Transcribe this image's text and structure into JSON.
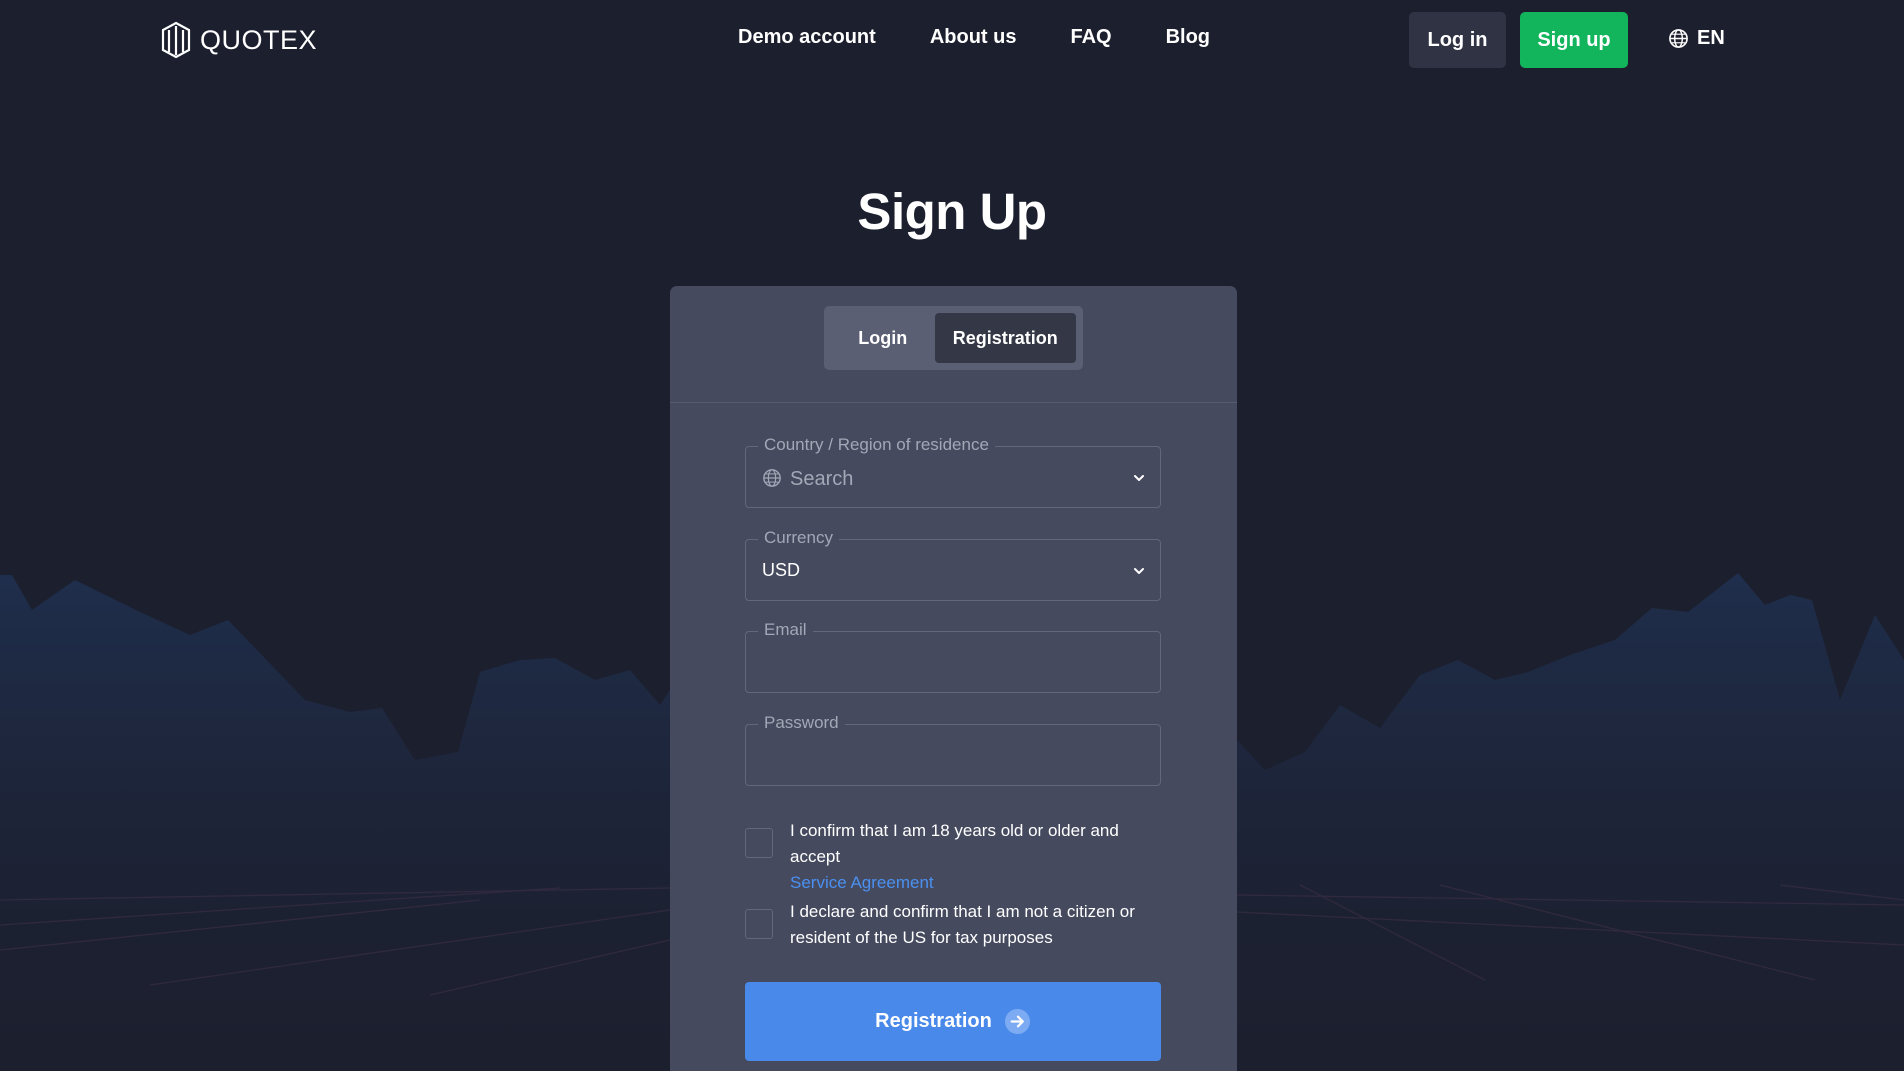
{
  "header": {
    "logo_text": "QUOTEX",
    "nav": [
      "Demo account",
      "About us",
      "FAQ",
      "Blog"
    ],
    "login_label": "Log in",
    "signup_label": "Sign up",
    "language": "EN"
  },
  "page_title": "Sign Up",
  "card": {
    "tabs": [
      {
        "label": "Login",
        "active": false
      },
      {
        "label": "Registration",
        "active": true
      }
    ],
    "country": {
      "label": "Country / Region of residence",
      "placeholder": "Search"
    },
    "currency": {
      "label": "Currency",
      "value": "USD"
    },
    "email": {
      "label": "Email",
      "value": ""
    },
    "password": {
      "label": "Password",
      "value": ""
    },
    "age_confirm": {
      "text": "I confirm that I am 18 years old or older and accept",
      "link": "Service Agreement",
      "checked": false
    },
    "us_confirm": {
      "text": "I declare and confirm that I am not a citizen or resident of the US for tax purposes",
      "checked": false
    },
    "submit_label": "Registration"
  },
  "colors": {
    "background": "#1c1f2e",
    "card": "#454a5e",
    "primary": "#4889ea",
    "success": "#12b45c",
    "link": "#4b90f0"
  },
  "icons": [
    "quotex-logo-icon",
    "globe-icon",
    "chevron-down-icon",
    "arrow-right-icon"
  ]
}
